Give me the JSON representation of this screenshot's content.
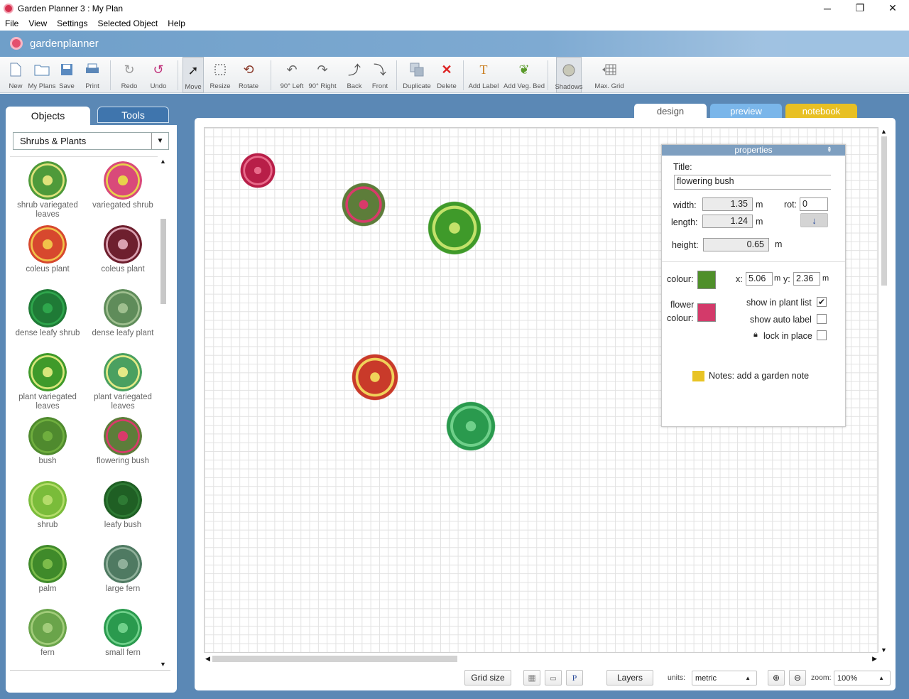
{
  "window": {
    "title": "Garden Planner 3 : My  Plan",
    "minimize": "─",
    "maximize": "❐",
    "close": "✕"
  },
  "menu": [
    "File",
    "View",
    "Settings",
    "Selected Object",
    "Help"
  ],
  "brand": {
    "name": "gardenplanner"
  },
  "toolbar": {
    "new": "New",
    "myplans": "My Plans",
    "save": "Save",
    "print": "Print",
    "redo": "Redo",
    "undo": "Undo",
    "move": "Move",
    "resize": "Resize",
    "rotate": "Rotate",
    "left90": "90° Left",
    "right90": "90° Right",
    "back": "Back",
    "front": "Front",
    "duplicate": "Duplicate",
    "delete": "Delete",
    "addlabel": "Add Label",
    "addveg": "Add Veg. Bed",
    "shadows": "Shadows",
    "maxgrid": "Max. Grid"
  },
  "left": {
    "tab_objects": "Objects",
    "tab_tools": "Tools",
    "category": "Shrubs & Plants",
    "plants": [
      {
        "name": "shrub variegated leaves",
        "color": "#4e9a3a",
        "accent": "#dfe27a"
      },
      {
        "name": "variegated shrub",
        "color": "#d94a7a",
        "accent": "#e8d24a"
      },
      {
        "name": "coleus plant",
        "color": "#d7482e",
        "accent": "#f1c24a"
      },
      {
        "name": "coleus plant",
        "color": "#6e1f2e",
        "accent": "#d9a0b0"
      },
      {
        "name": "dense leafy shrub",
        "color": "#1f7a36",
        "accent": "#2ea64c"
      },
      {
        "name": "dense leafy plant",
        "color": "#5f8c5a",
        "accent": "#9fbf8f"
      },
      {
        "name": "plant variegated leaves",
        "color": "#3f9a2a",
        "accent": "#d8e67a"
      },
      {
        "name": "plant variegated leaves",
        "color": "#4aa060",
        "accent": "#e3ea86"
      },
      {
        "name": "bush",
        "color": "#4f8a2e",
        "accent": "#6fae3e"
      },
      {
        "name": "flowering bush",
        "color": "#5d7d3a",
        "accent": "#d93a6a"
      },
      {
        "name": "shrub",
        "color": "#7abc3a",
        "accent": "#b4dc6a"
      },
      {
        "name": "leafy bush",
        "color": "#1f5f24",
        "accent": "#2e7a34"
      },
      {
        "name": "palm",
        "color": "#3f8a2a",
        "accent": "#7cbc4a"
      },
      {
        "name": "large fern",
        "color": "#4f7a62",
        "accent": "#8fb09a"
      },
      {
        "name": "fern",
        "color": "#6aa44a",
        "accent": "#a2cc7a"
      },
      {
        "name": "small fern",
        "color": "#2a9a4e",
        "accent": "#6fd08a"
      }
    ]
  },
  "viewtabs": {
    "design": "design",
    "preview": "preview",
    "notebook": "notebook"
  },
  "canvas": {
    "objects": [
      {
        "name": "coleus plant",
        "color": "#b81e48",
        "accent": "#e86a8a"
      },
      {
        "name": "flowering bush",
        "color": "#5d7d3a",
        "accent": "#d93a6a"
      },
      {
        "name": "palm",
        "color": "#3f9a2a",
        "accent": "#c3e26a"
      },
      {
        "name": "coleus plant",
        "color": "#c93a2a",
        "accent": "#f0d25a"
      },
      {
        "name": "small fern",
        "color": "#2a9a4e",
        "accent": "#6fd08a"
      }
    ]
  },
  "properties": {
    "header": "properties",
    "collapse": "⇞",
    "title_label": "Title:",
    "title_value": "flowering bush",
    "width_label": "width:",
    "width_value": "1.35",
    "width_unit": "m",
    "length_label": "length:",
    "length_value": "1.24",
    "length_unit": "m",
    "height_label": "height:",
    "height_value": "0.65",
    "height_unit": "m",
    "rot_label": "rot:",
    "rot_value": "0",
    "rot_btn": "↓",
    "colour_label": "colour:",
    "colour_value": "#4f8f2a",
    "flower_label_1": "flower",
    "flower_label_2": "colour:",
    "flower_value": "#d33a6a",
    "x_label": "x:",
    "x_value": "5.06",
    "x_unit": "m",
    "y_label": "y:",
    "y_value": "2.36",
    "y_unit": "m",
    "show_plant_list": "show in plant list",
    "show_plant_list_checked": "✔",
    "show_auto_label": "show auto label",
    "lock_in_place": "lock in place",
    "notes": "Notes: add a garden note"
  },
  "status": {
    "grid_size": "Grid size",
    "layers": "Layers",
    "units_label": "units:",
    "units_value": "metric",
    "zoom_label": "zoom:",
    "zoom_value": "100%",
    "p_btn": "P"
  }
}
